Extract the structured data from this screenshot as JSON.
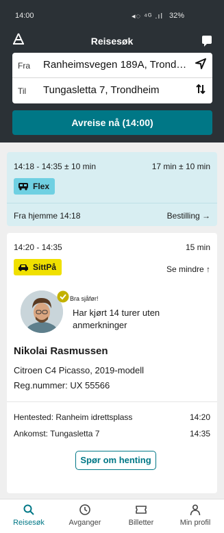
{
  "status_bar": {
    "time": "14:00",
    "icons": "◂◌ ⁴ᴳ .ıl",
    "battery": "32%"
  },
  "header": {
    "title": "Reisesøk",
    "logo_icon": "app-logo-icon",
    "chat_icon": "chat-icon"
  },
  "search": {
    "from_label": "Fra",
    "from_value": "Ranheimsvegen 189A, Trondheim",
    "to_label": "Til",
    "to_value": "Tungasletta 7, Trondheim",
    "location_icon": "location-arrow-icon",
    "swap_icon": "swap-icon"
  },
  "depart_button": "Avreise nå (14:00)",
  "flex_card": {
    "times": "14:18 - 14:35 ± 10 min",
    "duration": "17 min ± 10 min",
    "badge": "Flex",
    "pickup_text": "Fra hjemme 14:18",
    "order_link": "Bestilling →"
  },
  "sittpa_card": {
    "times": "14:20 - 14:35",
    "duration": "15 min",
    "badge": "SittPå",
    "show_less": "Se mindre ↑",
    "good_driver_tag": "Bra sjåfør!",
    "good_driver_text": "Har kjørt 14 turer uten anmerkninger",
    "driver_name": "Nikolai Rasmussen",
    "car_model": "Citroen C4 Picasso, 2019-modell",
    "registration": "Reg.nummer: UX 55566",
    "pickup_label": "Hentested: Ranheim idrettsplass",
    "pickup_time": "14:20",
    "arrival_label": "Ankomst: Tungasletta 7",
    "arrival_time": "14:35",
    "ask_button": "Spør om henting"
  },
  "colors": {
    "accent": "#007786",
    "flex_bg": "#d8eef2",
    "flex_badge": "#6fd0e2",
    "sittpa_badge": "#f0e000",
    "header_bg": "#2b3136"
  },
  "nav": [
    {
      "label": "Reisesøk",
      "icon": "search-icon",
      "active": true
    },
    {
      "label": "Avganger",
      "icon": "clock-icon",
      "active": false
    },
    {
      "label": "Billetter",
      "icon": "ticket-icon",
      "active": false
    },
    {
      "label": "Min profil",
      "icon": "profile-icon",
      "active": false
    }
  ]
}
